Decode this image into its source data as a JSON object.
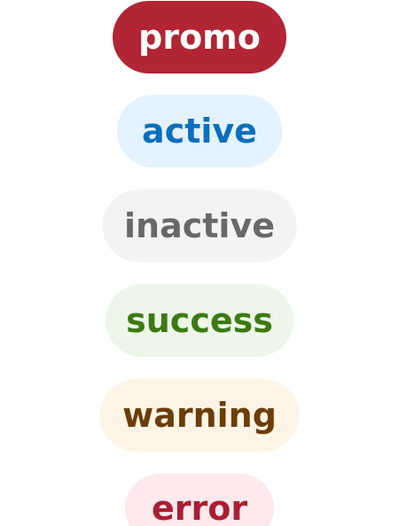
{
  "badges": [
    {
      "key": "promo",
      "label": "promo",
      "background": "#b22534",
      "text_color": "#ffffff"
    },
    {
      "key": "active",
      "label": "active",
      "background": "#e3f2fc",
      "text_color": "#0b6fbd"
    },
    {
      "key": "inactive",
      "label": "inactive",
      "background": "#f3f3f3",
      "text_color": "#686868"
    },
    {
      "key": "success",
      "label": "success",
      "background": "#edf6e8",
      "text_color": "#3d7a12"
    },
    {
      "key": "warning",
      "label": "warning",
      "background": "#fef4e6",
      "text_color": "#6b3d08"
    },
    {
      "key": "error",
      "label": "error",
      "background": "#fee9ec",
      "text_color": "#a91f33"
    }
  ]
}
